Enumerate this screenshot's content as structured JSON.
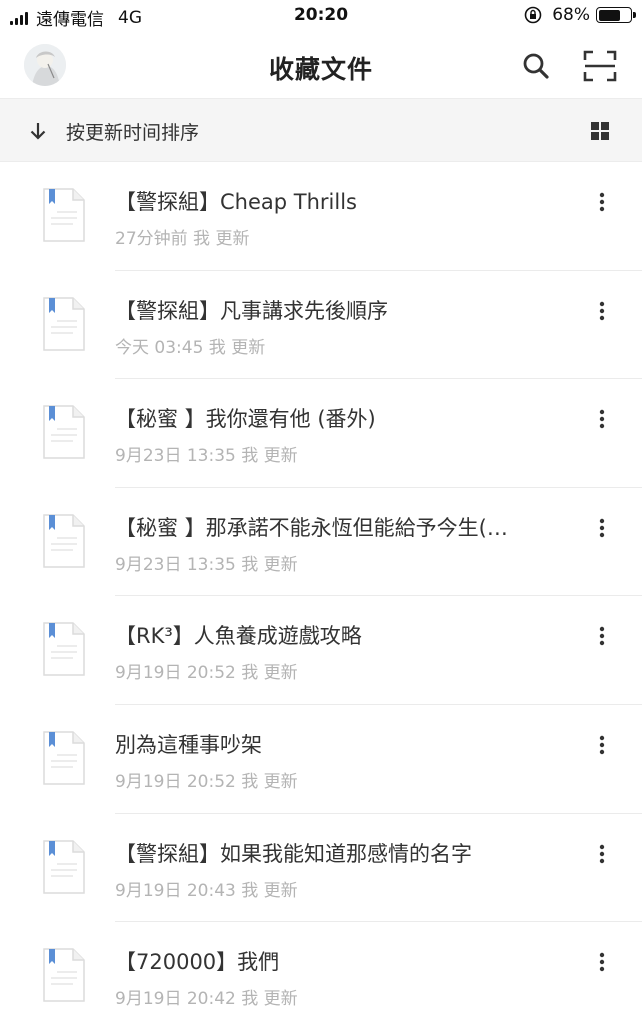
{
  "status_bar": {
    "carrier": "遠傳電信",
    "network": "4G",
    "time": "20:20",
    "battery_text": "68%",
    "battery_level": 0.68
  },
  "header": {
    "title": "收藏文件",
    "icons": [
      "avatar",
      "search-icon",
      "scan-icon"
    ]
  },
  "sort_bar": {
    "label": "按更新时间排序",
    "icons": [
      "arrow-down-icon",
      "grid-view-icon"
    ]
  },
  "files": [
    {
      "title": "【警探組】Cheap Thrills",
      "meta": "27分钟前 我 更新"
    },
    {
      "title": "【警探組】凡事講求先後順序",
      "meta": "今天 03:45 我 更新"
    },
    {
      "title": "【秘蜜 】我你還有他 (番外)",
      "meta": "9月23日 13:35 我 更新"
    },
    {
      "title": "【秘蜜 】那承諾不能永恆但能給予今生(…",
      "meta": "9月23日 13:35 我 更新"
    },
    {
      "title": "【RK³】人魚養成遊戲攻略",
      "meta": "9月19日 20:52 我 更新"
    },
    {
      "title": "別為這種事吵架",
      "meta": "9月19日 20:52 我 更新"
    },
    {
      "title": "【警探組】如果我能知道那感情的名字",
      "meta": "9月19日 20:43 我 更新"
    },
    {
      "title": "【720000】我們",
      "meta": "9月19日 20:42 我 更新"
    }
  ],
  "colors": {
    "doc_icon_bookmark": "#5b8fd6",
    "meta_text": "#b4b4b4",
    "sort_bar_bg": "#f5f5f5"
  }
}
